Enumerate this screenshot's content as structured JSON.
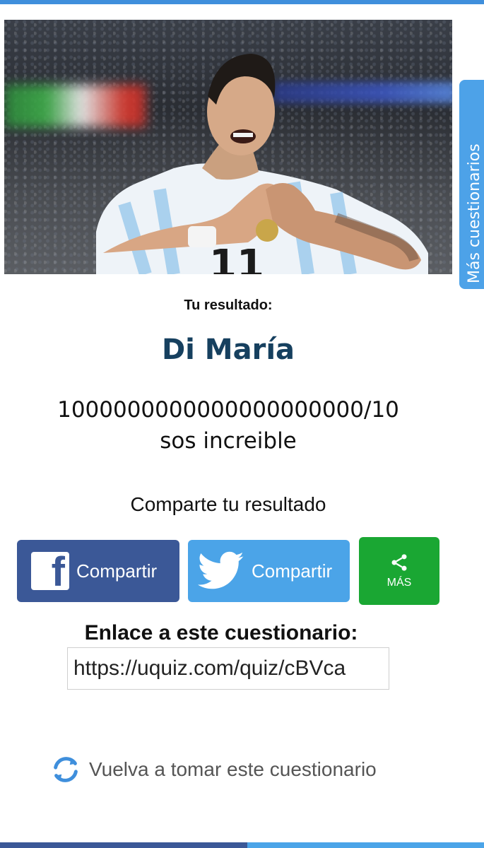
{
  "side_tab": {
    "label": "Más cuestionarios"
  },
  "result": {
    "label": "Tu resultado:",
    "title": "Di María",
    "description_line1": "1000000000000000000000/10",
    "description_line2": "sos increible"
  },
  "share": {
    "title": "Comparte tu resultado",
    "facebook_label": "Compartir",
    "twitter_label": "Compartir",
    "more_label": "MÁS"
  },
  "quiz_link": {
    "title": "Enlace a este cuestionario:",
    "value": "https://uquiz.com/quiz/cBVca"
  },
  "retake": {
    "label": "Vuelva a tomar este cuestionario"
  },
  "colors": {
    "accent": "#3f8fdc",
    "title": "#16405f",
    "facebook": "#3b5897",
    "twitter": "#4ba4e8",
    "more": "#1aa733"
  },
  "icons": [
    "facebook-icon",
    "twitter-icon",
    "share-icon",
    "refresh-icon"
  ]
}
